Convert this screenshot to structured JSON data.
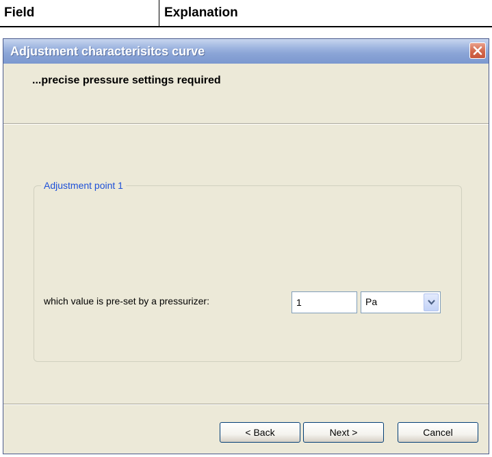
{
  "doc_table": {
    "col1": "Field",
    "col2": "Explanation"
  },
  "window": {
    "title": "Adjustment characterisitcs curve",
    "headline": "...precise pressure settings required",
    "group": {
      "legend": "Adjustment point 1",
      "field_label": "which value is pre-set by a pressurizer:",
      "value": "1",
      "unit_selected": "Pa"
    },
    "buttons": {
      "back": "< Back",
      "next": "Next >",
      "cancel": "Cancel"
    }
  },
  "colors": {
    "titlebar": "#8aa4d6",
    "window_bg": "#ece9d8",
    "legend_text": "#1c4fd8",
    "close_button": "#d2674a"
  },
  "icons": {
    "close": "close-icon",
    "dropdown": "chevron-down-icon"
  }
}
